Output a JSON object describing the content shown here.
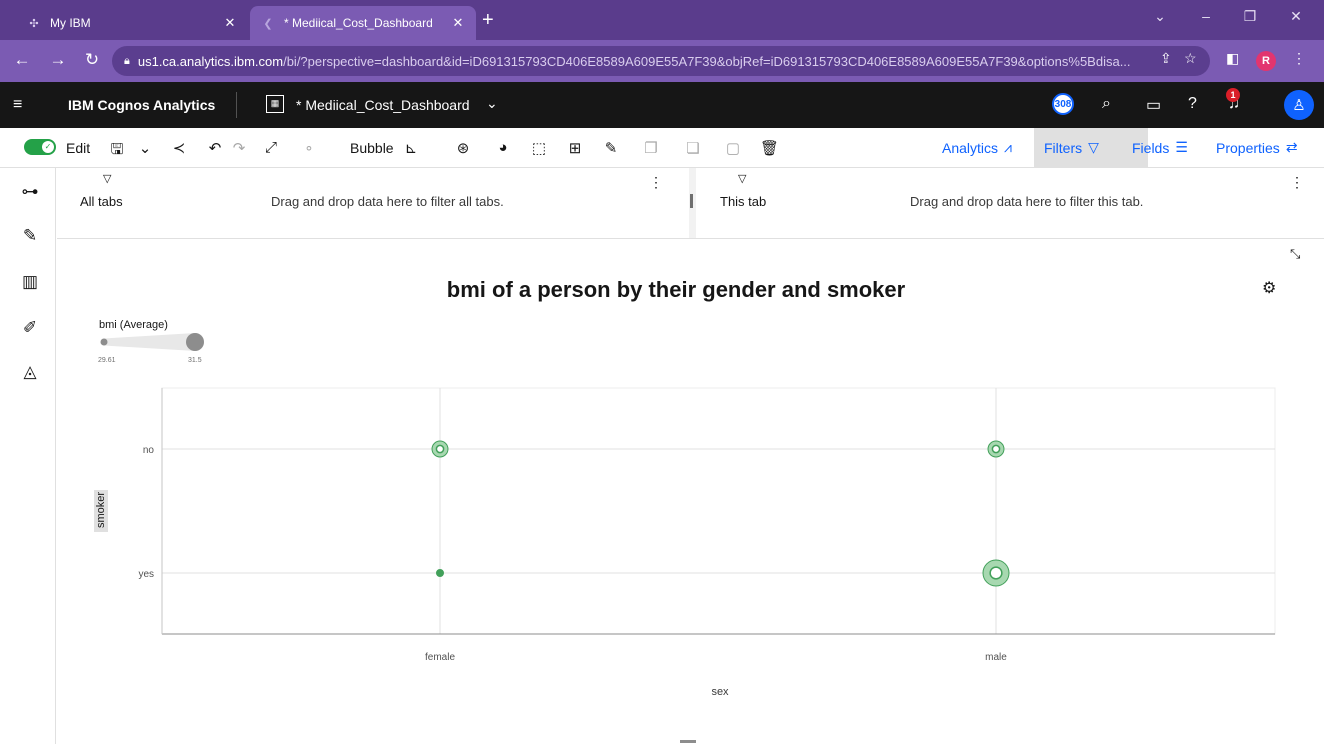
{
  "browser": {
    "tabs": [
      {
        "title": "My IBM",
        "active": false
      },
      {
        "title": "* Mediical_Cost_Dashboard",
        "active": true
      }
    ],
    "url_domain": "us1.ca.analytics.ibm.com",
    "url_rest": "/bi/?perspective=dashboard&id=iD691315793CD406E8589A609E55A7F39&objRef=iD691315793CD406E8589A609E55A7F39&options%5Bdisa...",
    "profile_initial": "R"
  },
  "app": {
    "name": "IBM Cognos Analytics",
    "dashboard_name": "* Mediical_Cost_Dashboard",
    "badge_count": "308",
    "notification_count": "1"
  },
  "toolbar": {
    "edit_label": "Edit",
    "viz_type_label": "Bubble",
    "right_tabs": [
      {
        "label": "Analytics",
        "icon": "analytics-icon",
        "active": false
      },
      {
        "label": "Filters",
        "icon": "filter-icon",
        "active": true
      },
      {
        "label": "Fields",
        "icon": "fields-icon",
        "active": false
      },
      {
        "label": "Properties",
        "icon": "properties-icon",
        "active": false
      }
    ]
  },
  "filters": {
    "all_tabs": {
      "title": "All tabs",
      "hint": "Drag and drop data here to filter all tabs."
    },
    "this_tab": {
      "title": "This tab",
      "hint": "Drag and drop data here to filter this tab."
    }
  },
  "colors": {
    "bubble_fill": "#a7d8b0",
    "bubble_stroke": "#42a05a",
    "accent": "#0f62fe",
    "browser_purple": "#7b5bb3"
  },
  "chart_data": {
    "type": "scatter",
    "title": "bmi of a person by their gender and smoker",
    "xlabel": "sex",
    "ylabel": "smoker",
    "x_categories": [
      "female",
      "male"
    ],
    "y_categories": [
      "no",
      "yes"
    ],
    "size_legend": {
      "title": "bmi (Average)",
      "min_label": "29.61",
      "max_label": "31.5",
      "min": 29.61,
      "max": 31.5
    },
    "points": [
      {
        "x": "female",
        "y": "no",
        "bmi_avg": 30.5
      },
      {
        "x": "male",
        "y": "no",
        "bmi_avg": 30.5
      },
      {
        "x": "female",
        "y": "yes",
        "bmi_avg": 29.61
      },
      {
        "x": "male",
        "y": "yes",
        "bmi_avg": 31.5
      }
    ],
    "grid": true
  }
}
